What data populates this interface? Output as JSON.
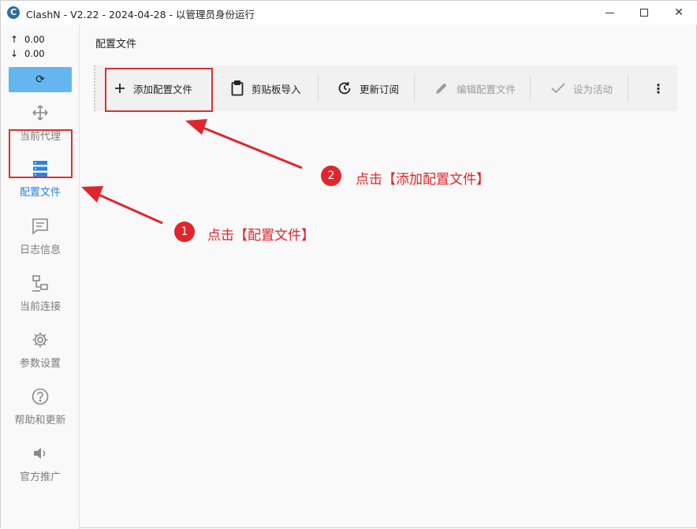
{
  "window": {
    "title": "ClashN - V2.22 - 2024-04-28 - 以管理员身份运行",
    "logo_letter": "C",
    "controls": {
      "minimize": "minimize-icon",
      "maximize": "maximize-icon",
      "close": "✕"
    }
  },
  "sidebar": {
    "upload_speed": "0.00",
    "download_speed": "0.00",
    "upload_arrow": "↑",
    "download_arrow": "↓",
    "refresh_icon": "⟳",
    "items": [
      {
        "label": "当前代理",
        "icon": "move-arrows-icon"
      },
      {
        "label": "配置文件",
        "icon": "server-stack-icon",
        "active": true
      },
      {
        "label": "日志信息",
        "icon": "message-lines-icon"
      },
      {
        "label": "当前连接",
        "icon": "network-lan-icon"
      },
      {
        "label": "参数设置",
        "icon": "gear-icon"
      },
      {
        "label": "帮助和更新",
        "icon": "help-circle-icon"
      },
      {
        "label": "官方推广",
        "icon": "speaker-icon"
      }
    ]
  },
  "main": {
    "page_title": "配置文件",
    "toolbar": {
      "add": "添加配置文件",
      "clipboard_import": "剪贴板导入",
      "update_subscription": "更新订阅",
      "edit": "编辑配置文件",
      "set_active": "设为活动",
      "more_icon": "⋮"
    }
  },
  "annotations": {
    "step1_number": "1",
    "step1_text": "点击【配置文件】",
    "step2_number": "2",
    "step2_text": "点击【添加配置文件】",
    "color": "#e0262c"
  },
  "colors": {
    "accent": "#2c84d6",
    "refresh_button": "#64b6f0",
    "highlight_border": "#d9312e"
  }
}
